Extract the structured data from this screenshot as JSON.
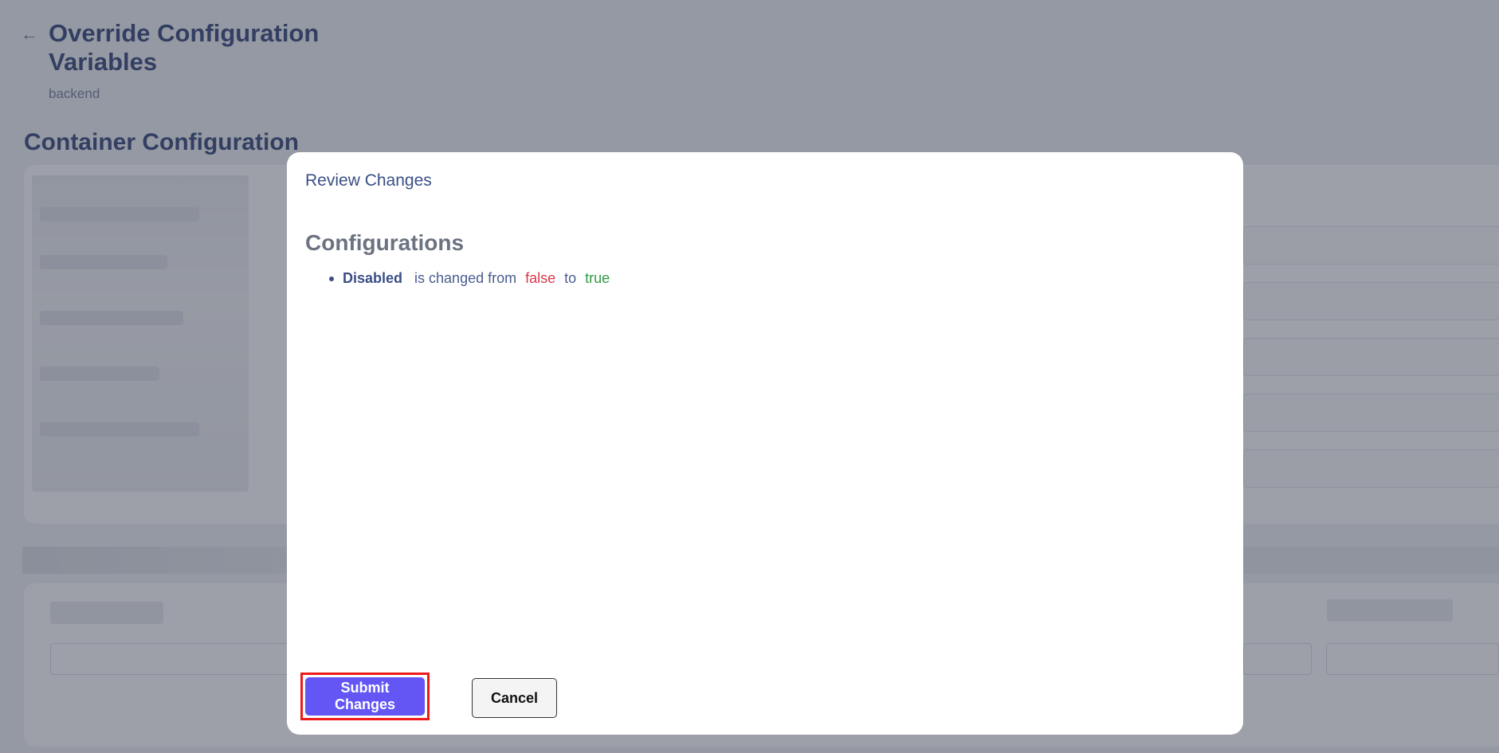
{
  "page": {
    "back_icon": "arrow-left-icon",
    "title": "Override Configuration Variables",
    "subtitle": "backend",
    "section_title": "Container Configuration"
  },
  "modal": {
    "title": "Review Changes",
    "section_title": "Configurations",
    "changes": [
      {
        "field": "Disabled",
        "connector": "is changed from",
        "old_value": "false",
        "to_word": "to",
        "new_value": "true"
      }
    ],
    "submit_label": "Submit Changes",
    "cancel_label": "Cancel"
  },
  "colors": {
    "primary_button": "#6356f5",
    "highlight_outline": "#ee1b1b",
    "old_value": "#d6394b",
    "new_value": "#2e9b45",
    "heading": "#2b3d72"
  }
}
